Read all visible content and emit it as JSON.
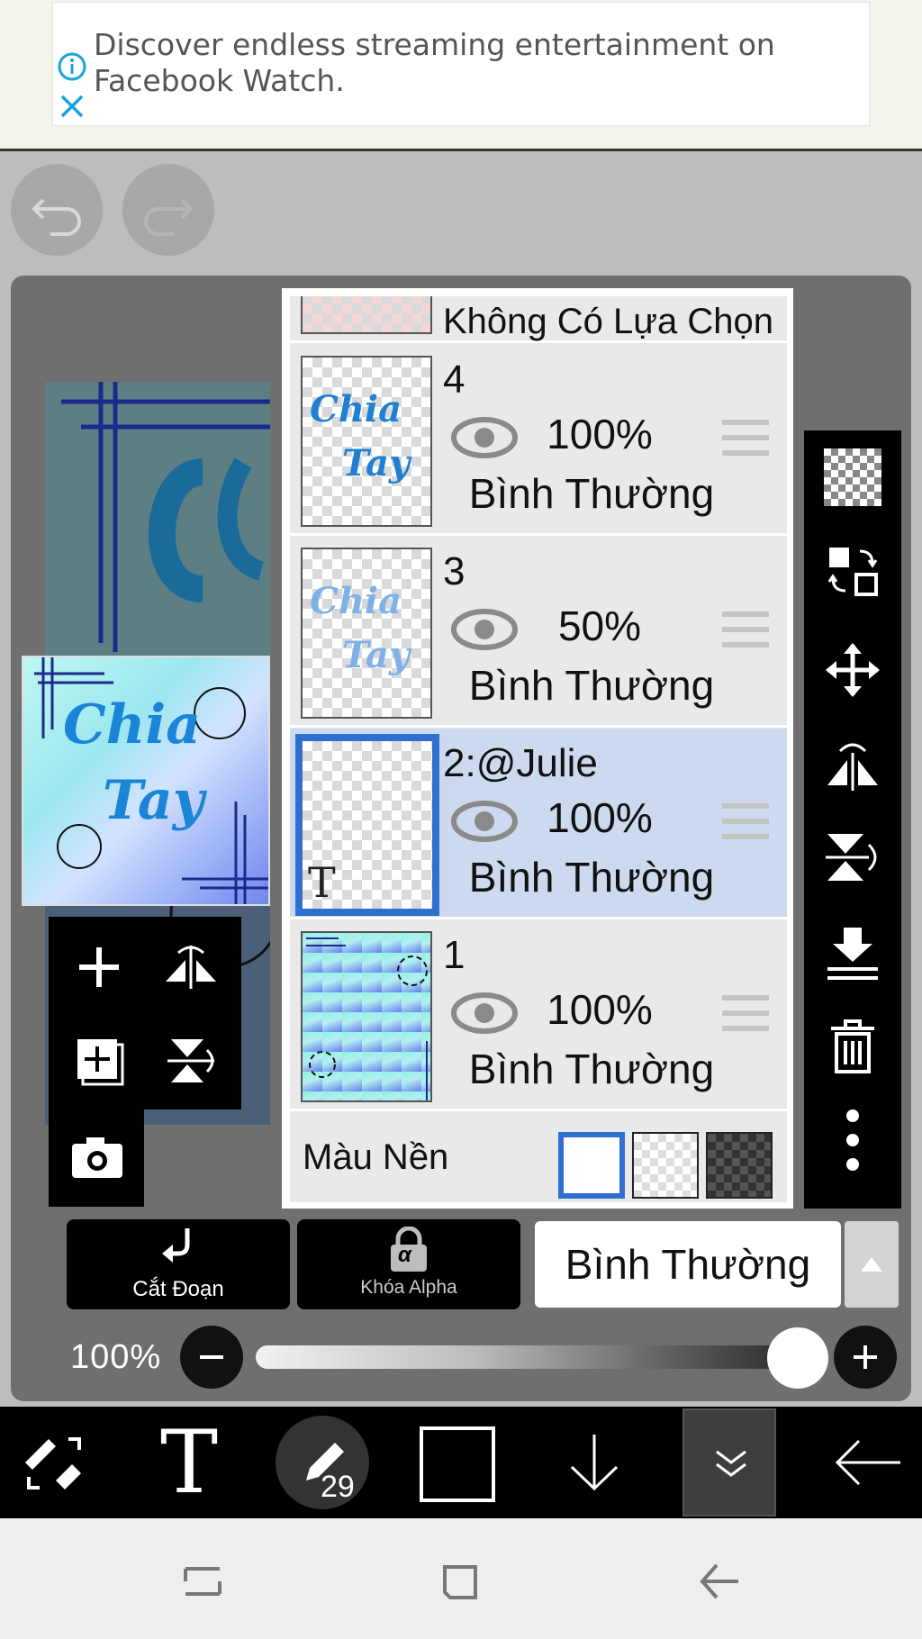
{
  "ad": {
    "text": "Discover endless streaming entertainment on Facebook Watch.",
    "icons": [
      "info-icon",
      "close-icon"
    ]
  },
  "history": {
    "icons": [
      "undo-icon",
      "redo-icon"
    ]
  },
  "layers_panel": {
    "top_partial": {
      "label": "Không Có Lựa Chọn"
    },
    "layers": [
      {
        "name": "4",
        "opacity": "100%",
        "mode": "Bình Thường",
        "visible": true,
        "selected": false,
        "thumb_text": [
          "Chia",
          "Tay"
        ]
      },
      {
        "name": "3",
        "opacity": "50%",
        "mode": "Bình Thường",
        "visible": true,
        "selected": false,
        "thumb_text": [
          "Chia",
          "Tay"
        ]
      },
      {
        "name": "2:@Julie",
        "opacity": "100%",
        "mode": "Bình Thường",
        "visible": true,
        "selected": true,
        "thumb_text": [
          "T"
        ]
      },
      {
        "name": "1",
        "opacity": "100%",
        "mode": "Bình Thường",
        "visible": true,
        "selected": false,
        "thumb_text": []
      }
    ],
    "background": {
      "label": "Màu Nền",
      "swatches": [
        "white",
        "transparent",
        "dark-checker"
      ],
      "selected": "white"
    }
  },
  "preview": {
    "text": [
      "Chia",
      "Tay"
    ]
  },
  "left_tools": {
    "icons": [
      "add-layer-icon",
      "flip-horizontal-icon",
      "duplicate-layer-icon",
      "flip-vertical-icon",
      "camera-icon"
    ]
  },
  "right_tools": {
    "icons": [
      "transparency-icon",
      "swap-layer-icon",
      "move-icon",
      "flip-h-icon",
      "flip-v-icon",
      "merge-down-icon",
      "trash-icon",
      "more-icon"
    ]
  },
  "actions": {
    "cut_label": "Cắt Đoạn",
    "alpha_label": "Khóa Alpha",
    "alpha_symbol": "α",
    "blend_mode": "Bình Thường"
  },
  "opacity_slider": {
    "label": "100%",
    "value": 1.0
  },
  "bottom_toolbar": {
    "brush_size": "29",
    "text_tool": "T",
    "icons": [
      "swap-tool-icon",
      "text-tool-icon",
      "brush-icon",
      "color-swatch",
      "arrow-down-icon",
      "expand-icon",
      "back-icon"
    ],
    "current_color": "#000000"
  },
  "nav": {
    "icons": [
      "recents-icon",
      "home-icon",
      "back-nav-icon"
    ]
  }
}
